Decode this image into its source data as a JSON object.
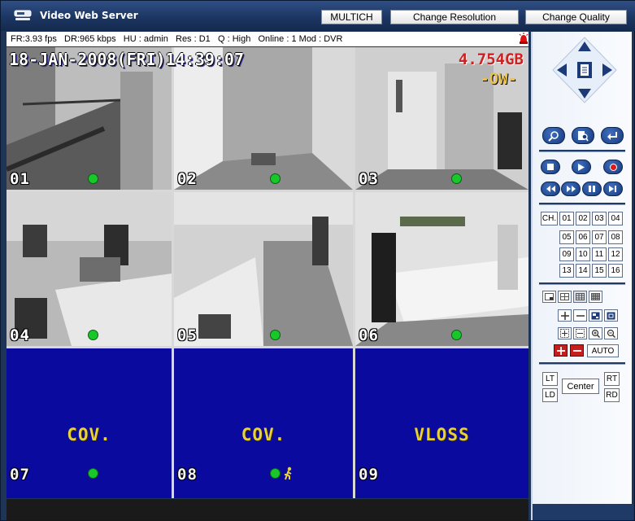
{
  "app": {
    "title": "Video Web Server"
  },
  "toolbar": {
    "multich": "MULTICH",
    "change_resolution": "Change Resolution",
    "change_quality": "Change Quality"
  },
  "status": {
    "fr": "FR:3.93 fps",
    "dr": "DR:965 kbps",
    "hu": "HU : admin",
    "res": "Res : D1",
    "q": "Q : High",
    "online": "Online : 1",
    "mod": "Mod : DVR"
  },
  "osd": {
    "datetime": "18-JAN-2008(FRI)14:39:07",
    "disk": "4.754GB",
    "mode": "-OW-"
  },
  "cells": [
    {
      "num": "01",
      "type": "camera",
      "dot": true
    },
    {
      "num": "02",
      "type": "camera",
      "dot": true
    },
    {
      "num": "03",
      "type": "camera",
      "dot": true
    },
    {
      "num": "04",
      "type": "camera",
      "dot": true
    },
    {
      "num": "05",
      "type": "camera",
      "dot": true
    },
    {
      "num": "06",
      "type": "camera",
      "dot": true
    },
    {
      "num": "07",
      "type": "lost",
      "message": "COV.",
      "dot": true
    },
    {
      "num": "08",
      "type": "lost",
      "message": "COV.",
      "dot": true,
      "motion": true
    },
    {
      "num": "09",
      "type": "lost",
      "message": "VLOSS",
      "dot": false
    }
  ],
  "panel": {
    "ch_label": "CH.",
    "channels": [
      "01",
      "02",
      "03",
      "04",
      "05",
      "06",
      "07",
      "08",
      "09",
      "10",
      "11",
      "12",
      "13",
      "14",
      "15",
      "16"
    ],
    "auto_label": "AUTO",
    "ptz": {
      "lt": "LT",
      "ld": "LD",
      "center": "Center",
      "rt": "RT",
      "rd": "RD"
    }
  },
  "colors": {
    "title_bar": "#1c3663",
    "no_video": "#0a0a9e",
    "osd_warn": "#e8d23a",
    "status_dot": "#18c82a",
    "disk_text": "#d02020"
  }
}
